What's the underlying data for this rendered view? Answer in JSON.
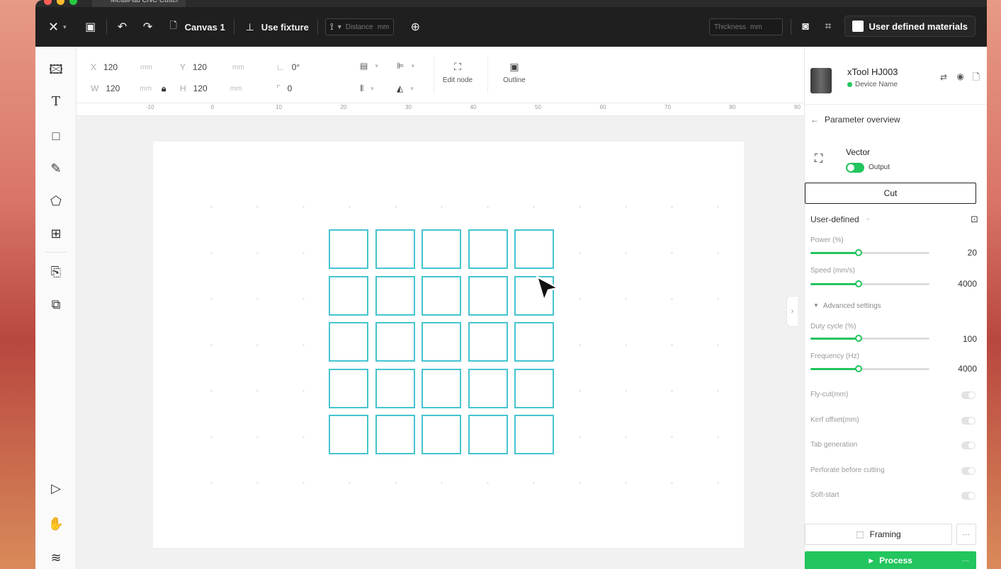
{
  "window": {
    "tab_title": "MetalFab CNC Cutter",
    "traffic_colors": [
      "#ff5f57",
      "#febc2e",
      "#28c840"
    ]
  },
  "toolbar": {
    "canvas_label": "Canvas 1",
    "fixture_label": "Use fixture",
    "distance_placeholder": "Distance",
    "distance_unit": "mm",
    "thickness_placeholder": "Thickness",
    "thickness_unit": "mm",
    "user_materials_label": "User defined materials"
  },
  "properties": {
    "x_label": "X",
    "x_value": "120",
    "x_unit": "mm",
    "y_label": "Y",
    "y_value": "120",
    "y_unit": "mm",
    "w_label": "W",
    "w_value": "120",
    "w_unit": "mm",
    "h_label": "H",
    "h_value": "120",
    "h_unit": "mm",
    "rotation": "0°",
    "corner_radius": "0",
    "edit_node_label": "Edit node",
    "outline_label": "Outline"
  },
  "ruler": {
    "ticks": [
      "-10",
      "0",
      "10",
      "20",
      "30",
      "40",
      "50",
      "60",
      "70",
      "80",
      "90"
    ]
  },
  "device": {
    "name": "xTool HJ003",
    "status": "Device Name"
  },
  "panel": {
    "back_label": "Parameter overview",
    "layer_type": "Vector",
    "output_label": "Output",
    "mode_button": "Cut",
    "preset": "User-defined",
    "power_label": "Power (%)",
    "power_value": "20",
    "speed_label": "Speed (mm/s)",
    "speed_value": "4000",
    "advanced_label": "Advanced settings",
    "duty_label": "Duty cycle (%)",
    "duty_value": "100",
    "freq_label": "Frequency (Hz)",
    "freq_value": "4000",
    "toggles": [
      "Fly-cut(mm)",
      "Kerf offset(mm)",
      "Tab generation",
      "Perforate before cutting",
      "Soft-start"
    ],
    "framing_label": "Framing",
    "process_label": "Process",
    "more_label": "···"
  },
  "colors": {
    "accent_green": "#22c55e",
    "shape_stroke": "#45c4cf",
    "toolbar_bg": "#1f1f1f"
  }
}
